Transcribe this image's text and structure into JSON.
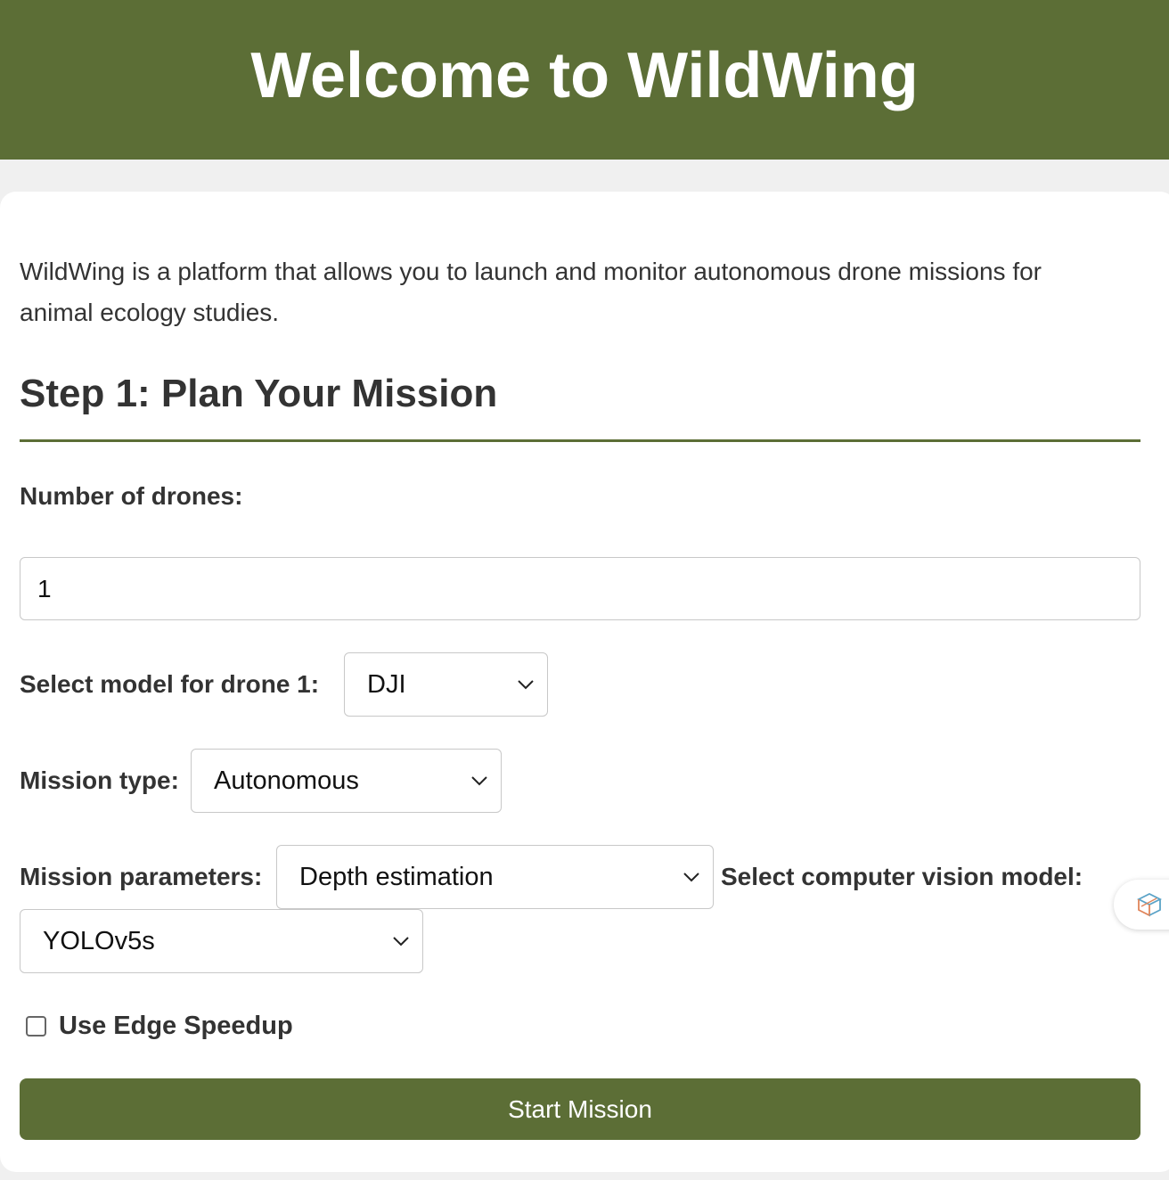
{
  "header": {
    "title": "Welcome to WildWing"
  },
  "intro": {
    "text": "WildWing is a platform that allows you to launch and monitor autonomous drone missions for animal ecology studies."
  },
  "step1": {
    "title": "Step 1: Plan Your Mission",
    "drone_count_label": "Number of drones:",
    "drone_count_value": "1",
    "drone_model_label": "Select model for drone 1:",
    "drone_model_value": "DJI",
    "mission_type_label": "Mission type:",
    "mission_type_value": "Autonomous",
    "mission_params_label": "Mission parameters:",
    "mission_params_value": "Depth estimation",
    "cv_model_label": "Select computer vision model:",
    "cv_model_value": "YOLOv5s",
    "edge_speedup_label": "Use Edge Speedup",
    "edge_speedup_checked": false,
    "start_button_label": "Start Mission"
  },
  "colors": {
    "brand": "#5c6e36",
    "page_bg": "#f0f0f0",
    "card_bg": "#ffffff"
  },
  "icons": {
    "select_arrow": "chevron-down-icon",
    "floating_widget": "cube-icon"
  }
}
